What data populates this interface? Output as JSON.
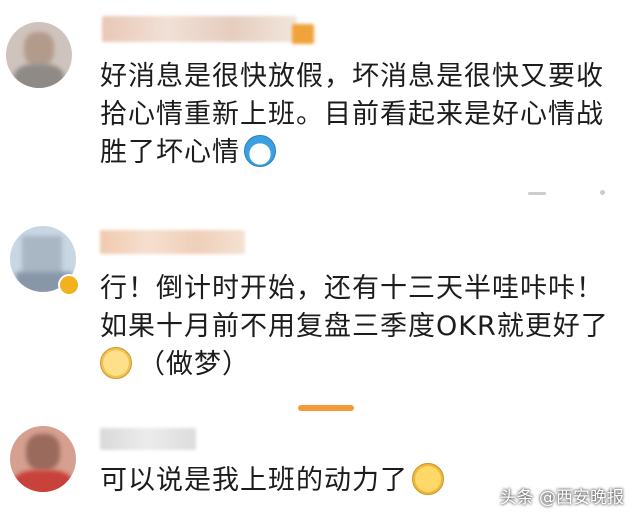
{
  "comments": [
    {
      "text": "好消息是很快放假，坏消息是很快又要收拾心情重新上班。目前看起来是好心情战胜了坏心情",
      "emoji": "doraemon-icon"
    },
    {
      "text_lines": [
        "行！倒计时开始，还有十三天半哇咔咔！",
        "如果十月前不用复盘三季度OKR就更好了"
      ],
      "extra": "（做梦）",
      "emoji": "glasses-face-icon"
    },
    {
      "text": "可以说是我上班的动力了",
      "emoji": "crying-face-icon"
    }
  ],
  "watermark": "头条 @西安晚报",
  "colors": {
    "accent": "#f39b3b",
    "text": "#1c1c1c"
  }
}
